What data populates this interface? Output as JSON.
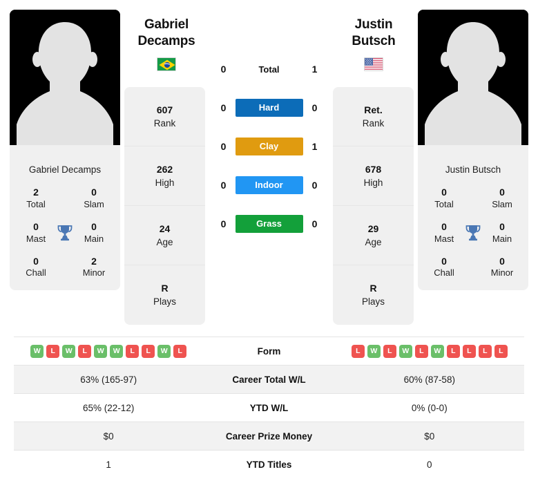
{
  "players": {
    "left": {
      "first_name": "Gabriel",
      "last_name": "Decamps",
      "full_name": "Gabriel Decamps",
      "country_flag": "brazil-flag",
      "avatar": "player-silhouette-placeholder",
      "rank": "607",
      "rank_label": "Rank",
      "high": "262",
      "high_label": "High",
      "age": "24",
      "age_label": "Age",
      "plays": "R",
      "plays_label": "Plays",
      "titles": {
        "total": "2",
        "total_label": "Total",
        "slam": "0",
        "slam_label": "Slam",
        "mast": "0",
        "mast_label": "Mast",
        "main": "0",
        "main_label": "Main",
        "chall": "0",
        "chall_label": "Chall",
        "minor": "2",
        "minor_label": "Minor"
      }
    },
    "right": {
      "first_name": "Justin",
      "last_name": "Butsch",
      "full_name": "Justin Butsch",
      "country_flag": "usa-flag",
      "avatar": "player-silhouette-placeholder",
      "rank": "Ret.",
      "rank_label": "Rank",
      "high": "678",
      "high_label": "High",
      "age": "29",
      "age_label": "Age",
      "plays": "R",
      "plays_label": "Plays",
      "titles": {
        "total": "0",
        "total_label": "Total",
        "slam": "0",
        "slam_label": "Slam",
        "mast": "0",
        "mast_label": "Mast",
        "main": "0",
        "main_label": "Main",
        "chall": "0",
        "chall_label": "Chall",
        "minor": "0",
        "minor_label": "Minor"
      }
    }
  },
  "head_to_head": [
    {
      "label": "Total",
      "left": "0",
      "right": "1",
      "color": null,
      "badge": false
    },
    {
      "label": "Hard",
      "left": "0",
      "right": "0",
      "color": "#0c6cb8",
      "badge": true
    },
    {
      "label": "Clay",
      "left": "0",
      "right": "1",
      "color": "#e09b10",
      "badge": true
    },
    {
      "label": "Indoor",
      "left": "0",
      "right": "0",
      "color": "#2196f3",
      "badge": true
    },
    {
      "label": "Grass",
      "left": "0",
      "right": "0",
      "color": "#13a03a",
      "badge": true
    }
  ],
  "comparison_rows": [
    {
      "label": "Form",
      "type": "form",
      "left_form": [
        "W",
        "L",
        "W",
        "L",
        "W",
        "W",
        "L",
        "L",
        "W",
        "L"
      ],
      "right_form": [
        "L",
        "W",
        "L",
        "W",
        "L",
        "W",
        "L",
        "L",
        "L",
        "L"
      ],
      "shaded": false
    },
    {
      "label": "Career Total W/L",
      "type": "text",
      "left": "63% (165-97)",
      "right": "60% (87-58)",
      "shaded": true
    },
    {
      "label": "YTD W/L",
      "type": "text",
      "left": "65% (22-12)",
      "right": "0% (0-0)",
      "shaded": false
    },
    {
      "label": "Career Prize Money",
      "type": "text",
      "left": "$0",
      "right": "$0",
      "shaded": true
    },
    {
      "label": "YTD Titles",
      "type": "text",
      "left": "1",
      "right": "0",
      "shaded": false
    }
  ],
  "colors": {
    "win_badge": "#6abf69",
    "loss_badge": "#ef5350",
    "trophy": "#4a77b4",
    "card_bg": "#f0f0f0",
    "row_shade": "#f2f2f2"
  },
  "icons": {
    "trophy": "trophy-icon"
  }
}
